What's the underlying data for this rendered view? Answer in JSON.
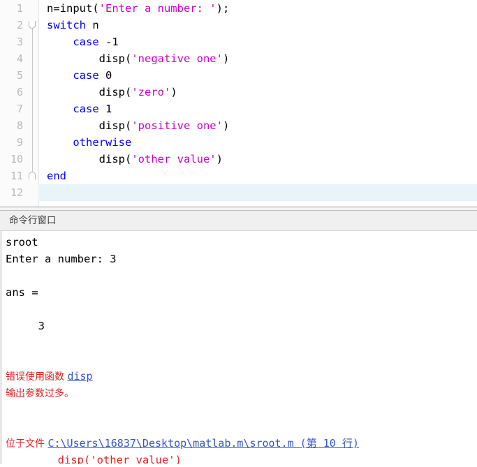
{
  "editor": {
    "name": "code-editor",
    "active_line": 12,
    "lines": [
      {
        "num": "1",
        "fold": "none",
        "tokens": [
          {
            "t": "pln",
            "s": "n=input("
          },
          {
            "t": "str",
            "s": "'Enter a number: '"
          },
          {
            "t": "pln",
            "s": ");"
          }
        ]
      },
      {
        "num": "2",
        "fold": "open",
        "tokens": [
          {
            "t": "kw",
            "s": "switch"
          },
          {
            "t": "pln",
            "s": " n"
          }
        ]
      },
      {
        "num": "3",
        "fold": "bar",
        "tokens": [
          {
            "t": "pln",
            "s": "    "
          },
          {
            "t": "kw",
            "s": "case"
          },
          {
            "t": "pln",
            "s": " -1"
          }
        ]
      },
      {
        "num": "4",
        "fold": "bar",
        "tokens": [
          {
            "t": "pln",
            "s": "        disp("
          },
          {
            "t": "str",
            "s": "'negative one'"
          },
          {
            "t": "pln",
            "s": ")"
          }
        ]
      },
      {
        "num": "5",
        "fold": "bar",
        "tokens": [
          {
            "t": "pln",
            "s": "    "
          },
          {
            "t": "kw",
            "s": "case"
          },
          {
            "t": "pln",
            "s": " 0"
          }
        ]
      },
      {
        "num": "6",
        "fold": "bar",
        "tokens": [
          {
            "t": "pln",
            "s": "        disp("
          },
          {
            "t": "str",
            "s": "'zero'"
          },
          {
            "t": "pln",
            "s": ")"
          }
        ]
      },
      {
        "num": "7",
        "fold": "bar",
        "tokens": [
          {
            "t": "pln",
            "s": "    "
          },
          {
            "t": "kw",
            "s": "case"
          },
          {
            "t": "pln",
            "s": " 1"
          }
        ]
      },
      {
        "num": "8",
        "fold": "bar",
        "tokens": [
          {
            "t": "pln",
            "s": "        disp("
          },
          {
            "t": "str",
            "s": "'positive one'"
          },
          {
            "t": "pln",
            "s": ")"
          }
        ]
      },
      {
        "num": "9",
        "fold": "bar",
        "tokens": [
          {
            "t": "pln",
            "s": "    "
          },
          {
            "t": "kw",
            "s": "otherwise"
          }
        ]
      },
      {
        "num": "10",
        "fold": "bar",
        "tokens": [
          {
            "t": "pln",
            "s": "        disp("
          },
          {
            "t": "str",
            "s": "'other value'"
          },
          {
            "t": "pln",
            "s": ")"
          }
        ]
      },
      {
        "num": "11",
        "fold": "close",
        "tokens": [
          {
            "t": "kw",
            "s": "end"
          }
        ]
      },
      {
        "num": "12",
        "fold": "none",
        "tokens": []
      }
    ]
  },
  "command_window": {
    "title": "命令行窗口",
    "lines": [
      {
        "name": "cmd-echo-sroot",
        "tokens": [
          {
            "t": "pln",
            "s": "sroot"
          }
        ]
      },
      {
        "name": "cmd-prompt-input",
        "tokens": [
          {
            "t": "pln",
            "s": "Enter a number: 3"
          }
        ]
      },
      {
        "name": "cmd-blank",
        "tokens": [
          {
            "t": "pln",
            "s": " "
          }
        ]
      },
      {
        "name": "cmd-ans-label",
        "tokens": [
          {
            "t": "pln",
            "s": "ans ="
          }
        ]
      },
      {
        "name": "cmd-blank",
        "tokens": [
          {
            "t": "pln",
            "s": " "
          }
        ]
      },
      {
        "name": "cmd-ans-value",
        "tokens": [
          {
            "t": "pln",
            "s": "     3"
          }
        ]
      },
      {
        "name": "cmd-blank",
        "tokens": [
          {
            "t": "pln",
            "s": " "
          }
        ]
      },
      {
        "name": "cmd-blank",
        "tokens": [
          {
            "t": "pln",
            "s": " "
          }
        ]
      },
      {
        "name": "cmd-error-heading",
        "tokens": [
          {
            "t": "err-cn",
            "s": "错误使用函数 "
          },
          {
            "t": "lnk-mono",
            "s": "disp"
          }
        ]
      },
      {
        "name": "cmd-error-detail",
        "tokens": [
          {
            "t": "err-cn",
            "s": "输出参数过多。"
          }
        ]
      },
      {
        "name": "cmd-blank",
        "tokens": [
          {
            "t": "pln",
            "s": " "
          }
        ]
      },
      {
        "name": "cmd-blank",
        "tokens": [
          {
            "t": "pln",
            "s": " "
          }
        ]
      },
      {
        "name": "cmd-error-location",
        "tokens": [
          {
            "t": "err-cn",
            "s": "位于文件 "
          },
          {
            "t": "lnk-mono",
            "s": "C:\\Users\\16837\\Desktop\\matlab.m\\sroot.m (第 10 行)"
          }
        ]
      },
      {
        "name": "cmd-error-source",
        "tokens": [
          {
            "t": "err",
            "s": "        disp('other value')"
          }
        ]
      }
    ]
  },
  "colors": {
    "keyword": "#0000ff",
    "string": "#cc00cc",
    "plain": "#000000",
    "error": "#e02020",
    "link": "#3355cc",
    "active_line_bg": "#e9f3fa",
    "gutter_bg": "#fbfbfb",
    "gutter_text": "#b9b9b9",
    "panel_title_bg": "#f0f0f0"
  }
}
